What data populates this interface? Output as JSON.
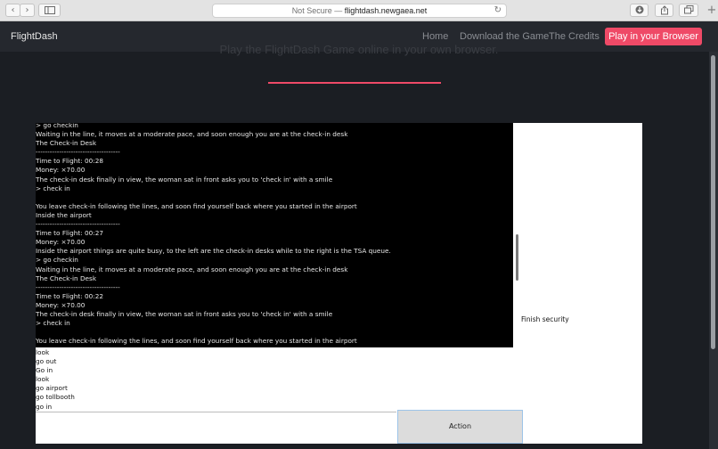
{
  "browser": {
    "back_glyph": "‹",
    "forward_glyph": "›",
    "url_prefix": "Not Secure — ",
    "url_host": "flightdash.newgaea.net",
    "reload_glyph": "↻",
    "plus_glyph": "+"
  },
  "nav": {
    "brand": "FlightDash",
    "links": [
      "Home",
      "Download the Game",
      "The Credits"
    ],
    "cta": "Play in your Browser"
  },
  "hero": {
    "subtitle": "Play the FlightDash Game online in your own browser."
  },
  "game": {
    "terminal_lines": [
      "> go checkin",
      "Waiting in the line, it moves at a moderate pace, and soon enough you are at the check-in desk",
      "The Check-in Desk",
      "------------------------------------",
      "Time to Flight: 00:28",
      "Money: ×70.00",
      "The check-in desk finally in view, the woman sat in front asks you to 'check in' with a smile",
      "> check in",
      "",
      "You leave check-in following the lines, and soon find yourself back where you started in the airport",
      "Inside the airport",
      "------------------------------------",
      "Time to Flight: 00:27",
      "Money: ×70.00",
      "Inside the airport things are quite busy, to the left are the check-in desks while to the right is the TSA queue.",
      "> go checkin",
      "Waiting in the line, it moves at a moderate pace, and soon enough you are at the check-in desk",
      "The Check-in Desk",
      "------------------------------------",
      "Time to Flight: 00:22",
      "Money: ×70.00",
      "The check-in desk finally in view, the woman sat in front asks you to 'check in' with a smile",
      "> check in",
      "",
      "You leave check-in following the lines, and soon find yourself back where you started in the airport"
    ],
    "status": "Finish security",
    "history": [
      "look",
      "go out",
      "Go in",
      "look",
      "go airport",
      "go tollbooth",
      "go in"
    ],
    "input_value": "",
    "action_label": "Action"
  }
}
